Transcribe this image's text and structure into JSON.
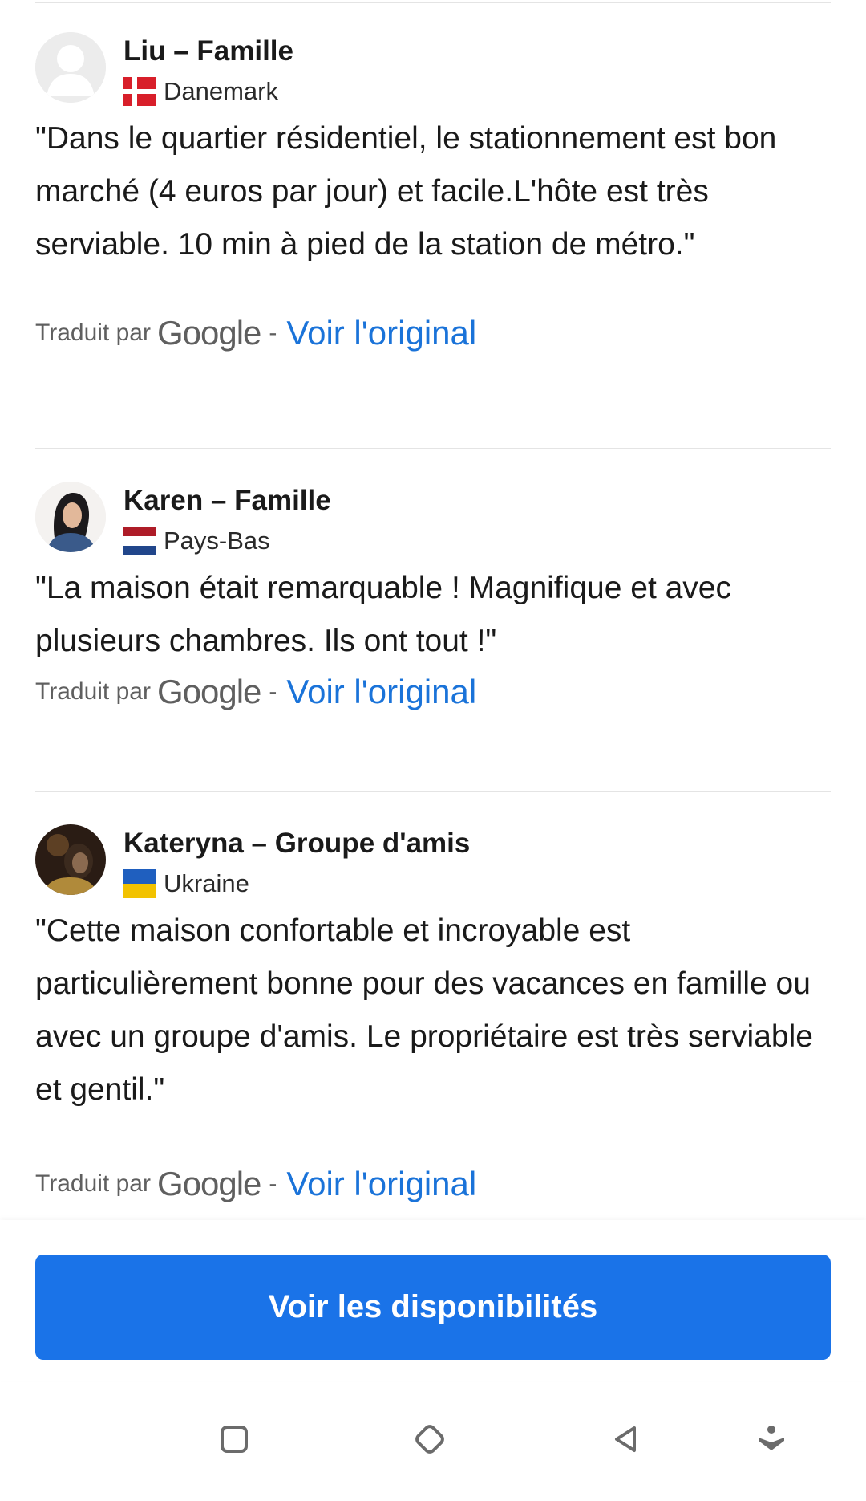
{
  "reviews": [
    {
      "name": "Liu – Famille",
      "country": "Danemark",
      "flag_icon": "denmark-flag-icon",
      "avatar_icon": "default-avatar-icon",
      "text": "\"Dans le quartier résidentiel, le stationnement est bon marché (4 euros par jour) et facile.L'hôte est très serviable. 10 min à pied de la station de métro.\"",
      "translated_by": "Traduit par",
      "google": "Google",
      "separator": "-",
      "see_original": "Voir l'original"
    },
    {
      "name": "Karen – Famille",
      "country": "Pays-Bas",
      "flag_icon": "netherlands-flag-icon",
      "avatar_icon": "user-photo-avatar",
      "text": "\"La maison était remarquable ! Magnifique et avec plusieurs chambres. Ils ont tout !\"",
      "translated_by": "Traduit par",
      "google": "Google",
      "separator": "-",
      "see_original": "Voir l'original"
    },
    {
      "name": "Kateryna – Groupe d'amis",
      "country": "Ukraine",
      "flag_icon": "ukraine-flag-icon",
      "avatar_icon": "user-photo-avatar",
      "text": "\"Cette maison confortable et incroyable est particulièrement bonne pour des vacances en famille ou avec un groupe d'amis. Le propriétaire est très serviable et gentil.\"",
      "translated_by": "Traduit par",
      "google": "Google",
      "separator": "-",
      "see_original": "Voir l'original"
    }
  ],
  "cta": {
    "label": "Voir les disponibilités"
  },
  "nav": {
    "items": [
      "recent-apps-icon",
      "home-icon",
      "back-icon",
      "accessibility-icon"
    ]
  },
  "colors": {
    "link": "#1a73d9",
    "button": "#1a73e8",
    "divider": "#e4e4e4",
    "nav_icon": "#6b6b6b"
  }
}
